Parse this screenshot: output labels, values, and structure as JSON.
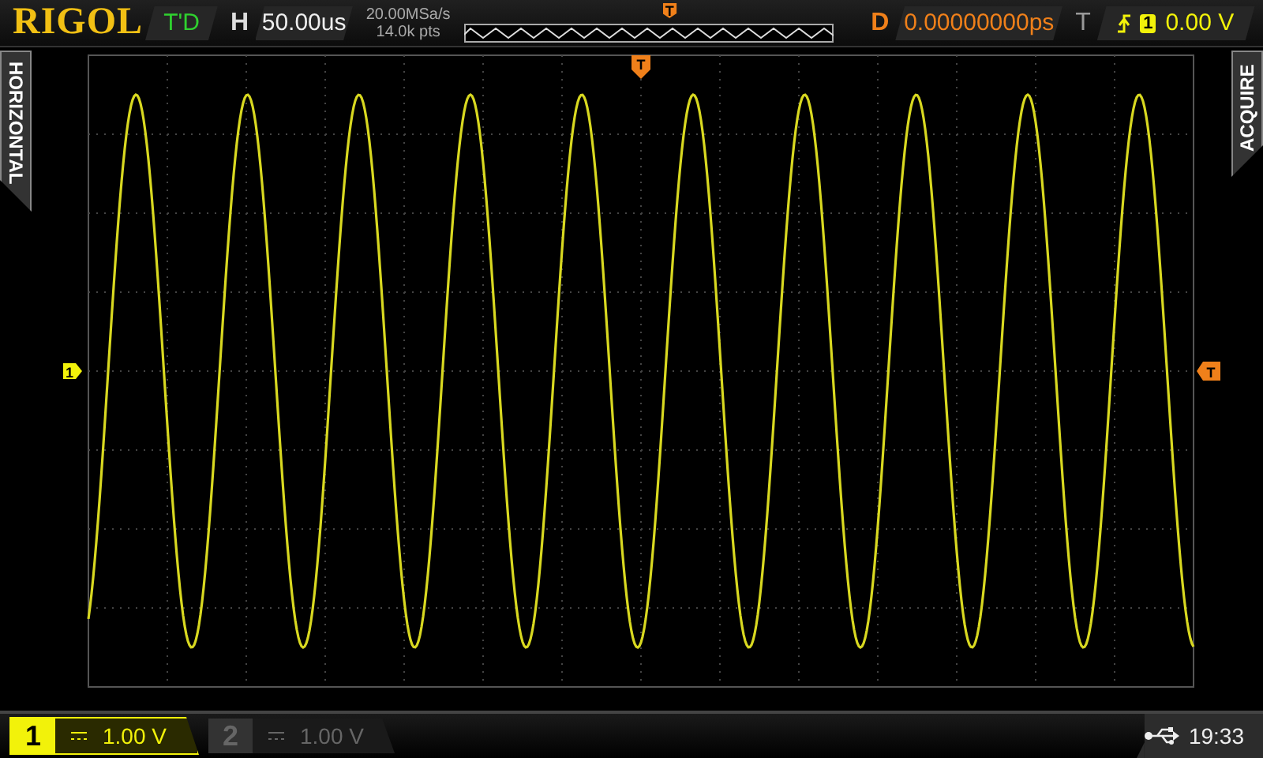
{
  "top_bar": {
    "logo": "RIGOL",
    "run_status": "T'D",
    "horizontal_label": "H",
    "timebase": "50.00us",
    "sample_rate": "20.00MSa/s",
    "memory_depth": "14.0k pts",
    "trigger_position_marker": "T",
    "delay_label": "D",
    "delay": "0.00000000ps",
    "trigger_label": "T",
    "trigger_source": "1",
    "trigger_level": "0.00 V"
  },
  "side_tabs": {
    "left": "HORIZONTAL",
    "right": "ACQUIRE"
  },
  "markers": {
    "trigger_position": "T",
    "channel_ground": "1",
    "trigger_level": "T"
  },
  "channels": [
    {
      "number": "1",
      "scale": "1.00 V",
      "selected": true
    },
    {
      "number": "2",
      "scale": "1.00 V",
      "selected": false
    }
  ],
  "status": {
    "time": "19:33"
  }
}
